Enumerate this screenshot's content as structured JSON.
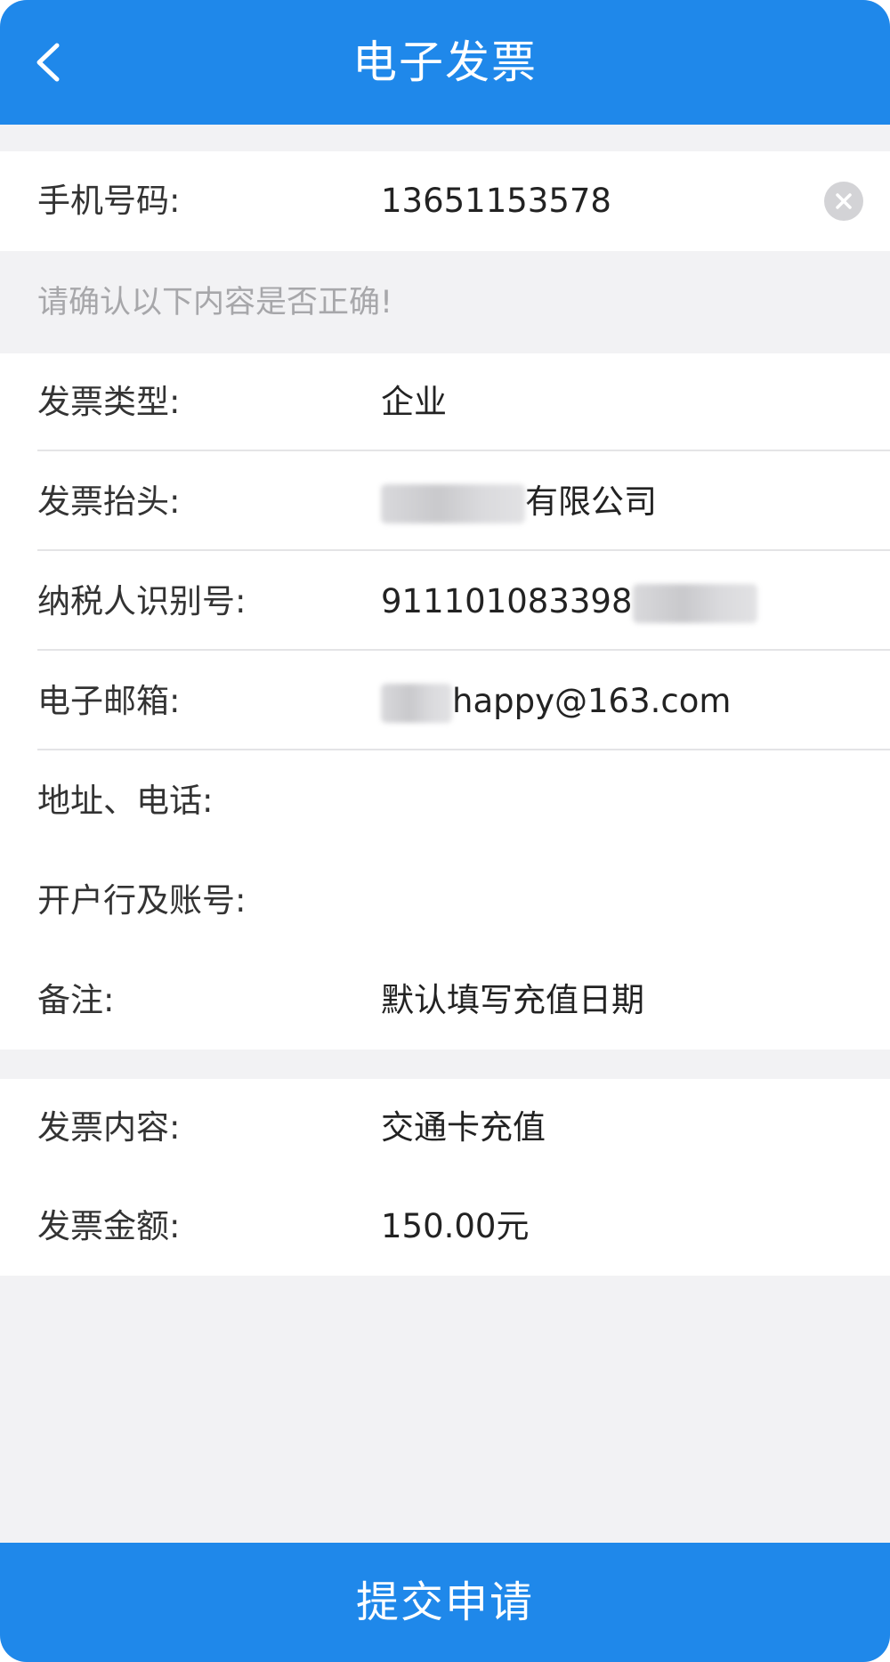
{
  "header": {
    "title": "电子发票",
    "back_icon": "chevron-left-icon"
  },
  "phone_row": {
    "label": "手机号码:",
    "value": "13651153578",
    "clear_icon": "clear-circle-icon"
  },
  "notice": "请确认以下内容是否正确!",
  "invoice_fields": [
    {
      "label": "发票类型:",
      "value": "企业"
    },
    {
      "label": "发票抬头:",
      "value": "有限公司"
    },
    {
      "label": "纳税人识别号:",
      "value": "911101083398"
    },
    {
      "label": "电子邮箱:",
      "value": "happy@163.com"
    },
    {
      "label": "地址、电话:",
      "value": ""
    },
    {
      "label": "开户行及账号:",
      "value": ""
    },
    {
      "label": "备注:",
      "value": "默认填写充值日期"
    }
  ],
  "content_fields": [
    {
      "label": "发票内容:",
      "value": "交通卡充值"
    },
    {
      "label": "发票金额:",
      "value": "150.00元"
    }
  ],
  "submit_label": "提交申请",
  "colors": {
    "brand_blue": "#1f88ea",
    "page_bg": "#f2f2f4",
    "card_bg": "#ffffff",
    "notice_text": "#a7a7aa"
  }
}
